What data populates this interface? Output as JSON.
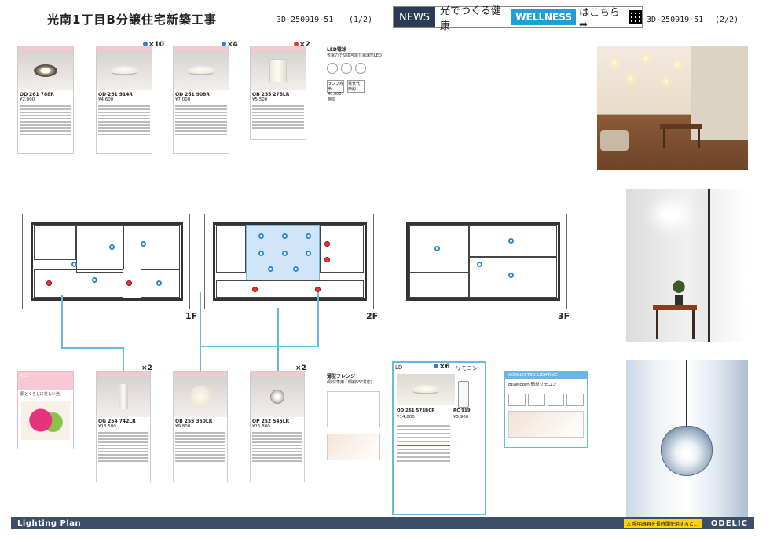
{
  "header": {
    "title": "光南1丁目B分譲住宅新築工事",
    "code_left": "3D-250919-51",
    "page_left": "(1/2)",
    "code_right": "3D-250919-51",
    "page_right": "(2/2)"
  },
  "news": {
    "tag": "NEWS",
    "text": "光でつくる健康",
    "wellness": "WELLNESS",
    "link": "はこちら➡"
  },
  "products_top": [
    {
      "code": "OD 261 788R",
      "price": "¥2,800",
      "qty": ""
    },
    {
      "code": "OD 261 914R",
      "price": "¥4,600",
      "qty": "×10"
    },
    {
      "code": "OD 261 908R",
      "price": "¥7,000",
      "qty": "×4"
    },
    {
      "code": "OB 255 278LR",
      "price": "¥5,500",
      "qty": "×2"
    }
  ],
  "led_info": {
    "title": "LED電球",
    "subtitle": "省電力で交換可能な電球形LED",
    "badge1": "ランプ寿命 40,000時間",
    "badge2": "電気代 節約"
  },
  "floors": {
    "f1": "1F",
    "f2": "2F",
    "f3": "3F"
  },
  "products_bottom": [
    {
      "code": "OG 254 742LR",
      "price": "¥13,500",
      "qty": "×2"
    },
    {
      "code": "OB 255 360LR",
      "price": "¥9,800",
      "qty": ""
    },
    {
      "code": "OP 252 545LR",
      "price": "¥15,800",
      "qty": "×2"
    }
  ],
  "r15": {
    "label": "R15",
    "text": "肌とくらしに美しい光。"
  },
  "flange": {
    "title": "薄型フレンジ",
    "sub": "(取付専用／傾斜55°対応)"
  },
  "ld_panel": {
    "tag": "LD",
    "qty": "×6",
    "remote_tag": "リモコン",
    "code": "OD 261 573BCR",
    "price": "¥14,800",
    "remote_code": "RC 919",
    "remote_price": "¥5,900"
  },
  "connected": {
    "bar": "CONNECTED LIGHTING",
    "text": "Bluetooth 簡単リモコン"
  },
  "footer": {
    "left": "Lighting Plan",
    "warn": "⚠ 照明器具を長時間使用すると…",
    "brand": "ODELIC"
  },
  "colors": {
    "accent_blue": "#6bb7e3",
    "marker_red": "#e23a3a",
    "marker_blue": "#2f86d6",
    "footer": "#3b4e6a",
    "news_tag": "#2b3b55",
    "wellness": "#1d9fd9"
  }
}
